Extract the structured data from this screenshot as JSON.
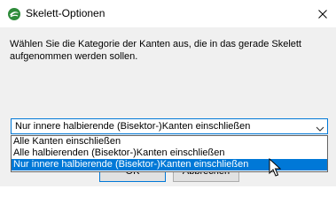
{
  "window": {
    "title": "Skelett-Optionen",
    "icon": "sketchup-logo-icon",
    "close_icon": "close-icon"
  },
  "message": "Wählen Sie die Kategorie der Kanten aus, die in das gerade Skelett aufgenommen werden sollen.",
  "combo": {
    "selected_value": "Nur innere halbierende (Bisektor-)Kanten einschließen",
    "arrow_icon": "chevron-down-icon"
  },
  "dropdown": {
    "options": [
      "Alle Kanten einschließen",
      "Alle halbierenden (Bisektor-)Kanten einschließen",
      "Nur innere halbierende (Bisektor-)Kanten einschließen"
    ],
    "highlighted_index": 2
  },
  "buttons": {
    "ok_label": "OK",
    "cancel_label": "Abbrechen"
  },
  "colors": {
    "accent": "#0078d7",
    "dialog_bg": "#f0f0f0",
    "titlebar_bg": "#ffffff"
  }
}
